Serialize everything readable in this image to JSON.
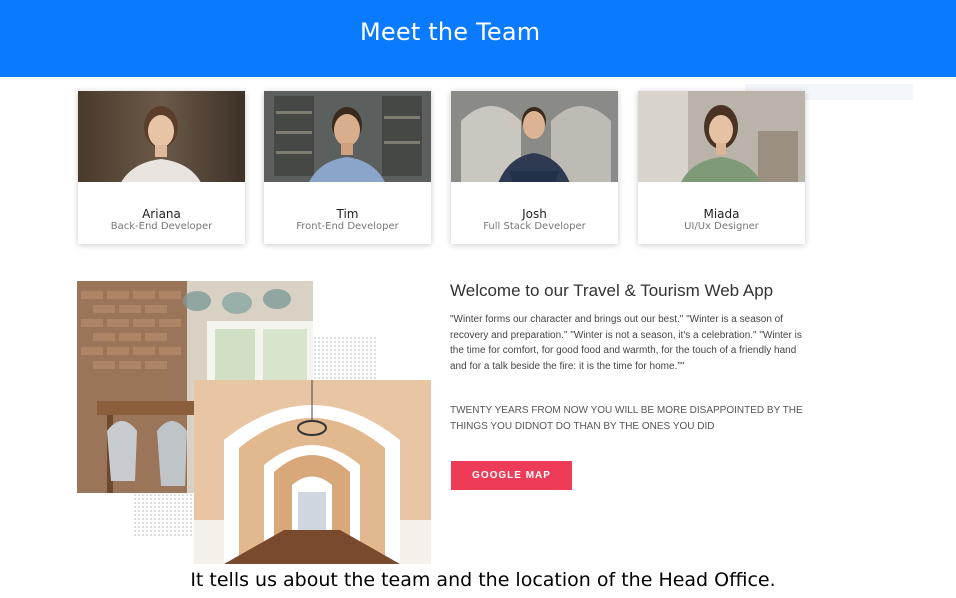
{
  "header": {
    "title": "Meet the Team",
    "background": "#0a7bff"
  },
  "team": [
    {
      "name": "Ariana",
      "role": "Back-End Developer"
    },
    {
      "name": "Tim",
      "role": "Front-End Developer"
    },
    {
      "name": "Josh",
      "role": "Full Stack Developer"
    },
    {
      "name": "Miada",
      "role": "UI/Ux Designer"
    }
  ],
  "welcome": {
    "title": "Welcome to our Travel & Tourism Web App",
    "quote": "\"Winter forms our character and brings out our best.\" \"Winter is a season of recovery and preparation.\" \"Winter is not a season, it's a celebration.\" \"Winter is the time for comfort, for good food and warmth, for the touch of a friendly hand and for a talk beside the fire: it is the time for home.\"\"",
    "caps": "TWENTY YEARS FROM NOW YOU WILL BE MORE DISAPPOINTED BY THE THINGS YOU DIDNOT DO THAN BY THE ONES YOU DID",
    "button_label": "GOOGLE MAP",
    "button_color": "#ee3b58"
  },
  "caption": "It tells us about the team and the location of the Head Office."
}
